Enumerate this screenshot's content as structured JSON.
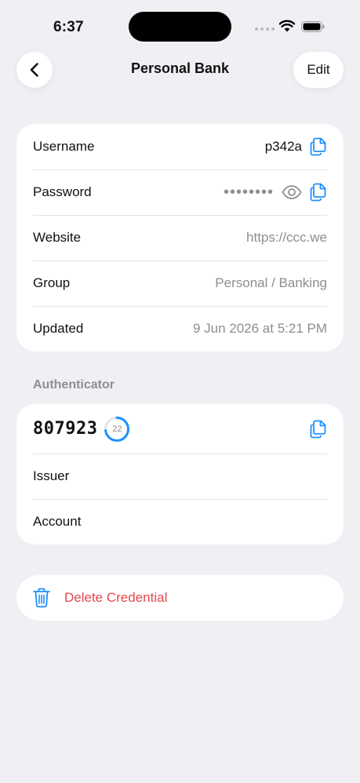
{
  "status_bar": {
    "time": "6:37"
  },
  "nav": {
    "title": "Personal Bank",
    "edit_label": "Edit"
  },
  "details": {
    "username": {
      "label": "Username",
      "value": "p342a"
    },
    "password": {
      "label": "Password",
      "value": "••••••••"
    },
    "website": {
      "label": "Website",
      "value": "https://ccc.we"
    },
    "group": {
      "label": "Group",
      "value": "Personal / Banking"
    },
    "updated": {
      "label": "Updated",
      "value": "9 Jun 2026 at 5:21 PM"
    }
  },
  "authenticator": {
    "section_title": "Authenticator",
    "code": "807923",
    "seconds_remaining": "22",
    "timer_fraction": 0.73,
    "issuer_label": "Issuer",
    "account_label": "Account"
  },
  "delete": {
    "label": "Delete Credential"
  },
  "colors": {
    "accent": "#1e90ff",
    "danger": "#e5484d",
    "background": "#efeff4"
  }
}
